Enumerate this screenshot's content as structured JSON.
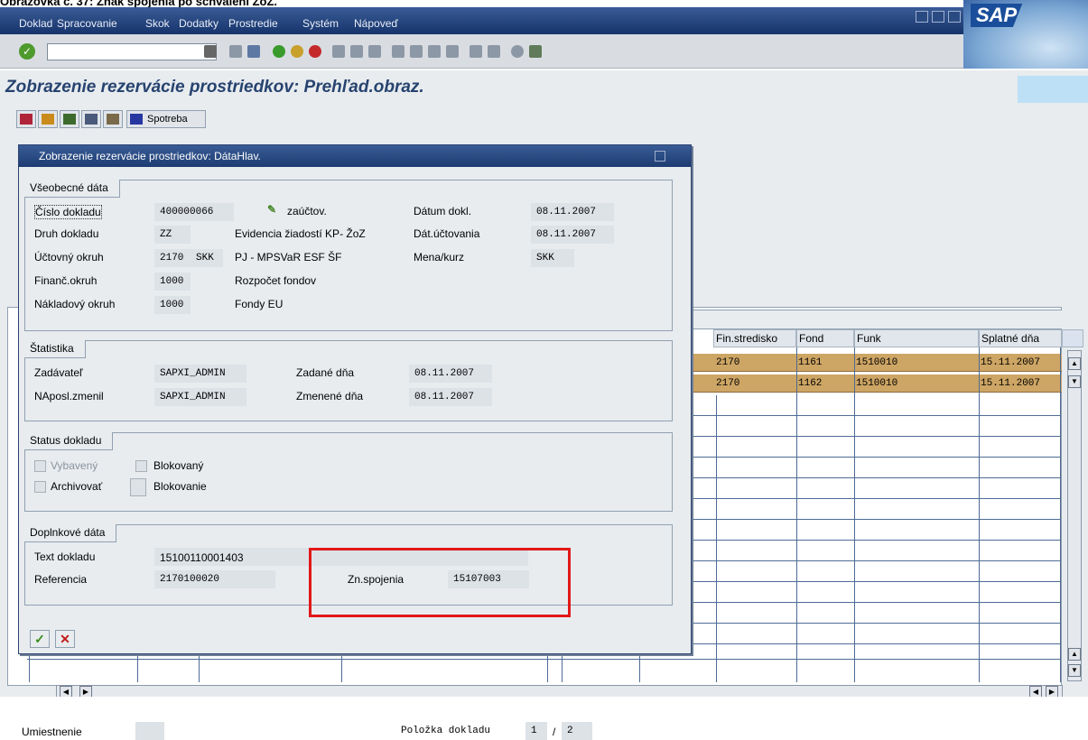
{
  "caption": "Obrazovka č. 37: Znak spojenia po schválení ŽoZ.",
  "menu": [
    "Doklad",
    "Spracovanie",
    "Skok",
    "Dodatky",
    "Prostredie",
    "Systém",
    "Nápoveď"
  ],
  "logo_text": "SAP",
  "title": "Zobrazenie rezervácie prostriedkov: Prehľad.obraz.",
  "app_toolbar": {
    "spotreba_label": "Spotreba"
  },
  "dialog": {
    "title": "Zobrazenie rezervácie prostriedkov: DátaHlav.",
    "general": {
      "group_title": "Všeobecné dáta",
      "cislo_dokladu_label": "Číslo dokladu",
      "cislo_dokladu_value": "400000066",
      "status_text": "zaúčtov.",
      "datum_dokl_label": "Dátum dokl.",
      "datum_dokl_value": "08.11.2007",
      "druh_dokladu_label": "Druh dokladu",
      "druh_dokladu_value": "ZZ",
      "druh_dokladu_desc": "Evidencia žiadostí KP- ŽoZ",
      "dat_uctovania_label": "Dát.účtovania",
      "dat_uctovania_value": "08.11.2007",
      "uctovny_okruh_label": "Účtovný okruh",
      "uctovny_okruh_value": "2170",
      "uctovny_okruh_curr": "SKK",
      "uctovny_okruh_desc": "PJ - MPSVaR ESF ŠF",
      "mena_label": "Mena/kurz",
      "mena_value": "SKK",
      "financ_okruh_label": "Finanč.okruh",
      "financ_okruh_value": "1000",
      "financ_okruh_desc": "Rozpočet fondov",
      "nakladovy_okruh_label": "Nákladový okruh",
      "nakladovy_okruh_value": "1000",
      "nakladovy_okruh_desc": "Fondy EU"
    },
    "stats": {
      "group_title": "Štatistika",
      "zadavatel_label": "Zadávateľ",
      "zadavatel_value": "SAPXI_ADMIN",
      "zadane_label": "Zadané dňa",
      "zadane_value": "08.11.2007",
      "naposl_label": "NAposl.zmenil",
      "naposl_value": "SAPXI_ADMIN",
      "zmenene_label": "Zmenené dňa",
      "zmenene_value": "08.11.2007"
    },
    "status": {
      "group_title": "Status dokladu",
      "vybaveny": "Vybavený",
      "blokovany": "Blokovaný",
      "archivovat": "Archivovať",
      "blokovanie": "Blokovanie"
    },
    "extra": {
      "group_title": "Doplnkové dáta",
      "text_dokladu_label": "Text dokladu",
      "text_dokladu_value": "15100110001403",
      "referencia_label": "Referencia",
      "referencia_value": "2170100020",
      "zn_spojenia_label": "Zn.spojenia",
      "zn_spojenia_value": "15107003"
    }
  },
  "table": {
    "headers": [
      "Fin.stredisko",
      "Fond",
      "Funk",
      "Splatné dňa"
    ],
    "rows": [
      [
        "2170",
        "1161",
        "1510010",
        "15.11.2007"
      ],
      [
        "2170",
        "1162",
        "1510010",
        "15.11.2007"
      ]
    ]
  },
  "footer": {
    "umiestnenie_label": "Umiestnenie",
    "polozka_label": "Položka dokladu",
    "polozka_current": "1",
    "polozka_sep": "/",
    "polozka_total": "2"
  }
}
